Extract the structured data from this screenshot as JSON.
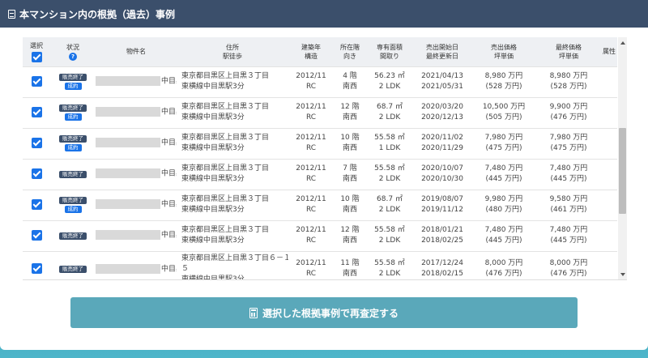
{
  "header": {
    "title": "本マンション内の根拠（過去）事例"
  },
  "columns": {
    "select": "選択",
    "status": "状況",
    "status_help": "?",
    "name": "物件名",
    "address": [
      "住所",
      "駅徒歩"
    ],
    "built": [
      "建築年",
      "構造"
    ],
    "floor": [
      "所在階",
      "向き"
    ],
    "area": [
      "専有面積",
      "間取り"
    ],
    "dates": [
      "売出開始日",
      "最終更新日"
    ],
    "sale_price": [
      "売出価格",
      "坪単価"
    ],
    "final_price": [
      "最終価格",
      "坪単価"
    ],
    "attr": "属性"
  },
  "rows": [
    {
      "badges": [
        "販売終了",
        "成約"
      ],
      "name_suffix": "中目黒",
      "address": [
        "東京都目黒区上目黒３丁目",
        "東横線中目黒駅3分"
      ],
      "built": [
        "2012/11",
        "RC"
      ],
      "floor": [
        "4 階",
        "南西"
      ],
      "area": [
        "56.23 ㎡",
        "2 LDK"
      ],
      "dates": [
        "2021/04/13",
        "2021/05/31"
      ],
      "sale_price": [
        "8,980 万円",
        "(528 万円)"
      ],
      "final_price": [
        "8,980 万円",
        "(528 万円)"
      ]
    },
    {
      "badges": [
        "販売終了",
        "成約"
      ],
      "name_suffix": "中目黒",
      "address": [
        "東京都目黒区上目黒３丁目",
        "東横線中目黒駅3分"
      ],
      "built": [
        "2012/11",
        "RC"
      ],
      "floor": [
        "12 階",
        "南西"
      ],
      "area": [
        "68.7 ㎡",
        "2 LDK"
      ],
      "dates": [
        "2020/03/20",
        "2020/12/13"
      ],
      "sale_price": [
        "10,500 万円",
        "(505 万円)"
      ],
      "final_price": [
        "9,900 万円",
        "(476 万円)"
      ]
    },
    {
      "badges": [
        "販売終了",
        "成約"
      ],
      "name_suffix": "中目黒",
      "address": [
        "東京都目黒区上目黒３丁目",
        "東横線中目黒駅3分"
      ],
      "built": [
        "2012/11",
        "RC"
      ],
      "floor": [
        "10 階",
        "南西"
      ],
      "area": [
        "55.58 ㎡",
        "1 LDK"
      ],
      "dates": [
        "2020/11/02",
        "2020/11/29"
      ],
      "sale_price": [
        "7,980 万円",
        "(475 万円)"
      ],
      "final_price": [
        "7,980 万円",
        "(475 万円)"
      ]
    },
    {
      "badges": [
        "販売終了"
      ],
      "name_suffix": "中目黒",
      "address": [
        "東京都目黒区上目黒３丁目",
        "東横線中目黒駅3分"
      ],
      "built": [
        "2012/11",
        "RC"
      ],
      "floor": [
        "7 階",
        "南西"
      ],
      "area": [
        "55.58 ㎡",
        "2 LDK"
      ],
      "dates": [
        "2020/10/07",
        "2020/10/30"
      ],
      "sale_price": [
        "7,480 万円",
        "(445 万円)"
      ],
      "final_price": [
        "7,480 万円",
        "(445 万円)"
      ]
    },
    {
      "badges": [
        "販売終了",
        "成約"
      ],
      "name_suffix": "中目黒",
      "address": [
        "東京都目黒区上目黒３丁目",
        "東横線中目黒駅3分"
      ],
      "built": [
        "2012/11",
        "RC"
      ],
      "floor": [
        "10 階",
        "南西"
      ],
      "area": [
        "68.7 ㎡",
        "2 LDK"
      ],
      "dates": [
        "2019/08/07",
        "2019/11/12"
      ],
      "sale_price": [
        "9,980 万円",
        "(480 万円)"
      ],
      "final_price": [
        "9,580 万円",
        "(461 万円)"
      ]
    },
    {
      "badges": [
        "販売終了"
      ],
      "name_suffix": "中目黒",
      "address": [
        "東京都目黒区上目黒３丁目",
        "東横線中目黒駅3分"
      ],
      "built": [
        "2012/11",
        "RC"
      ],
      "floor": [
        "12 階",
        "南西"
      ],
      "area": [
        "55.58 ㎡",
        "2 LDK"
      ],
      "dates": [
        "2018/01/21",
        "2018/02/25"
      ],
      "sale_price": [
        "7,480 万円",
        "(445 万円)"
      ],
      "final_price": [
        "7,480 万円",
        "(445 万円)"
      ]
    },
    {
      "badges": [
        "販売終了"
      ],
      "name_suffix": "中目黒",
      "address": [
        "東京都目黒区上目黒３丁目６－１",
        "５",
        "東横線中目黒駅3分"
      ],
      "built": [
        "2012/11",
        "RC"
      ],
      "floor": [
        "11 階",
        "南西"
      ],
      "area": [
        "55.58 ㎡",
        "2 LDK"
      ],
      "dates": [
        "2017/12/24",
        "2018/02/15"
      ],
      "sale_price": [
        "8,000 万円",
        "(476 万円)"
      ],
      "final_price": [
        "8,000 万円",
        "(476 万円)"
      ]
    }
  ],
  "submit": {
    "label": "選択した根拠事例で再査定する"
  },
  "icons": {
    "header": "document-icon",
    "submit": "calculator-icon"
  },
  "colors": {
    "header_bg": "#3b4f6b",
    "accent": "#1a73e8",
    "button_bg": "#5aa8ba"
  }
}
